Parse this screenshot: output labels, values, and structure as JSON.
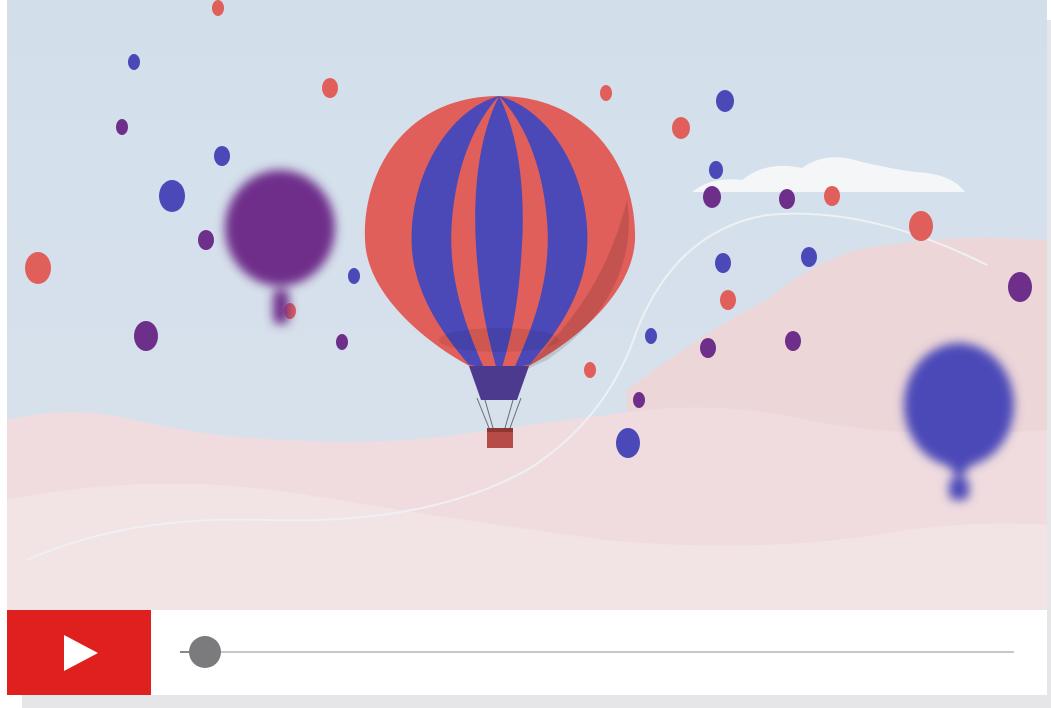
{
  "player": {
    "play_icon": "play-icon",
    "accent_color": "#e0201f",
    "progress": 0.03
  },
  "scene": {
    "sky_color": "#d3e0ec",
    "hill_color": "#f0dbdd",
    "balloon_colors": {
      "red": "#e05f5a",
      "blue": "#4b48b8",
      "purple": "#6e2f8a"
    }
  }
}
